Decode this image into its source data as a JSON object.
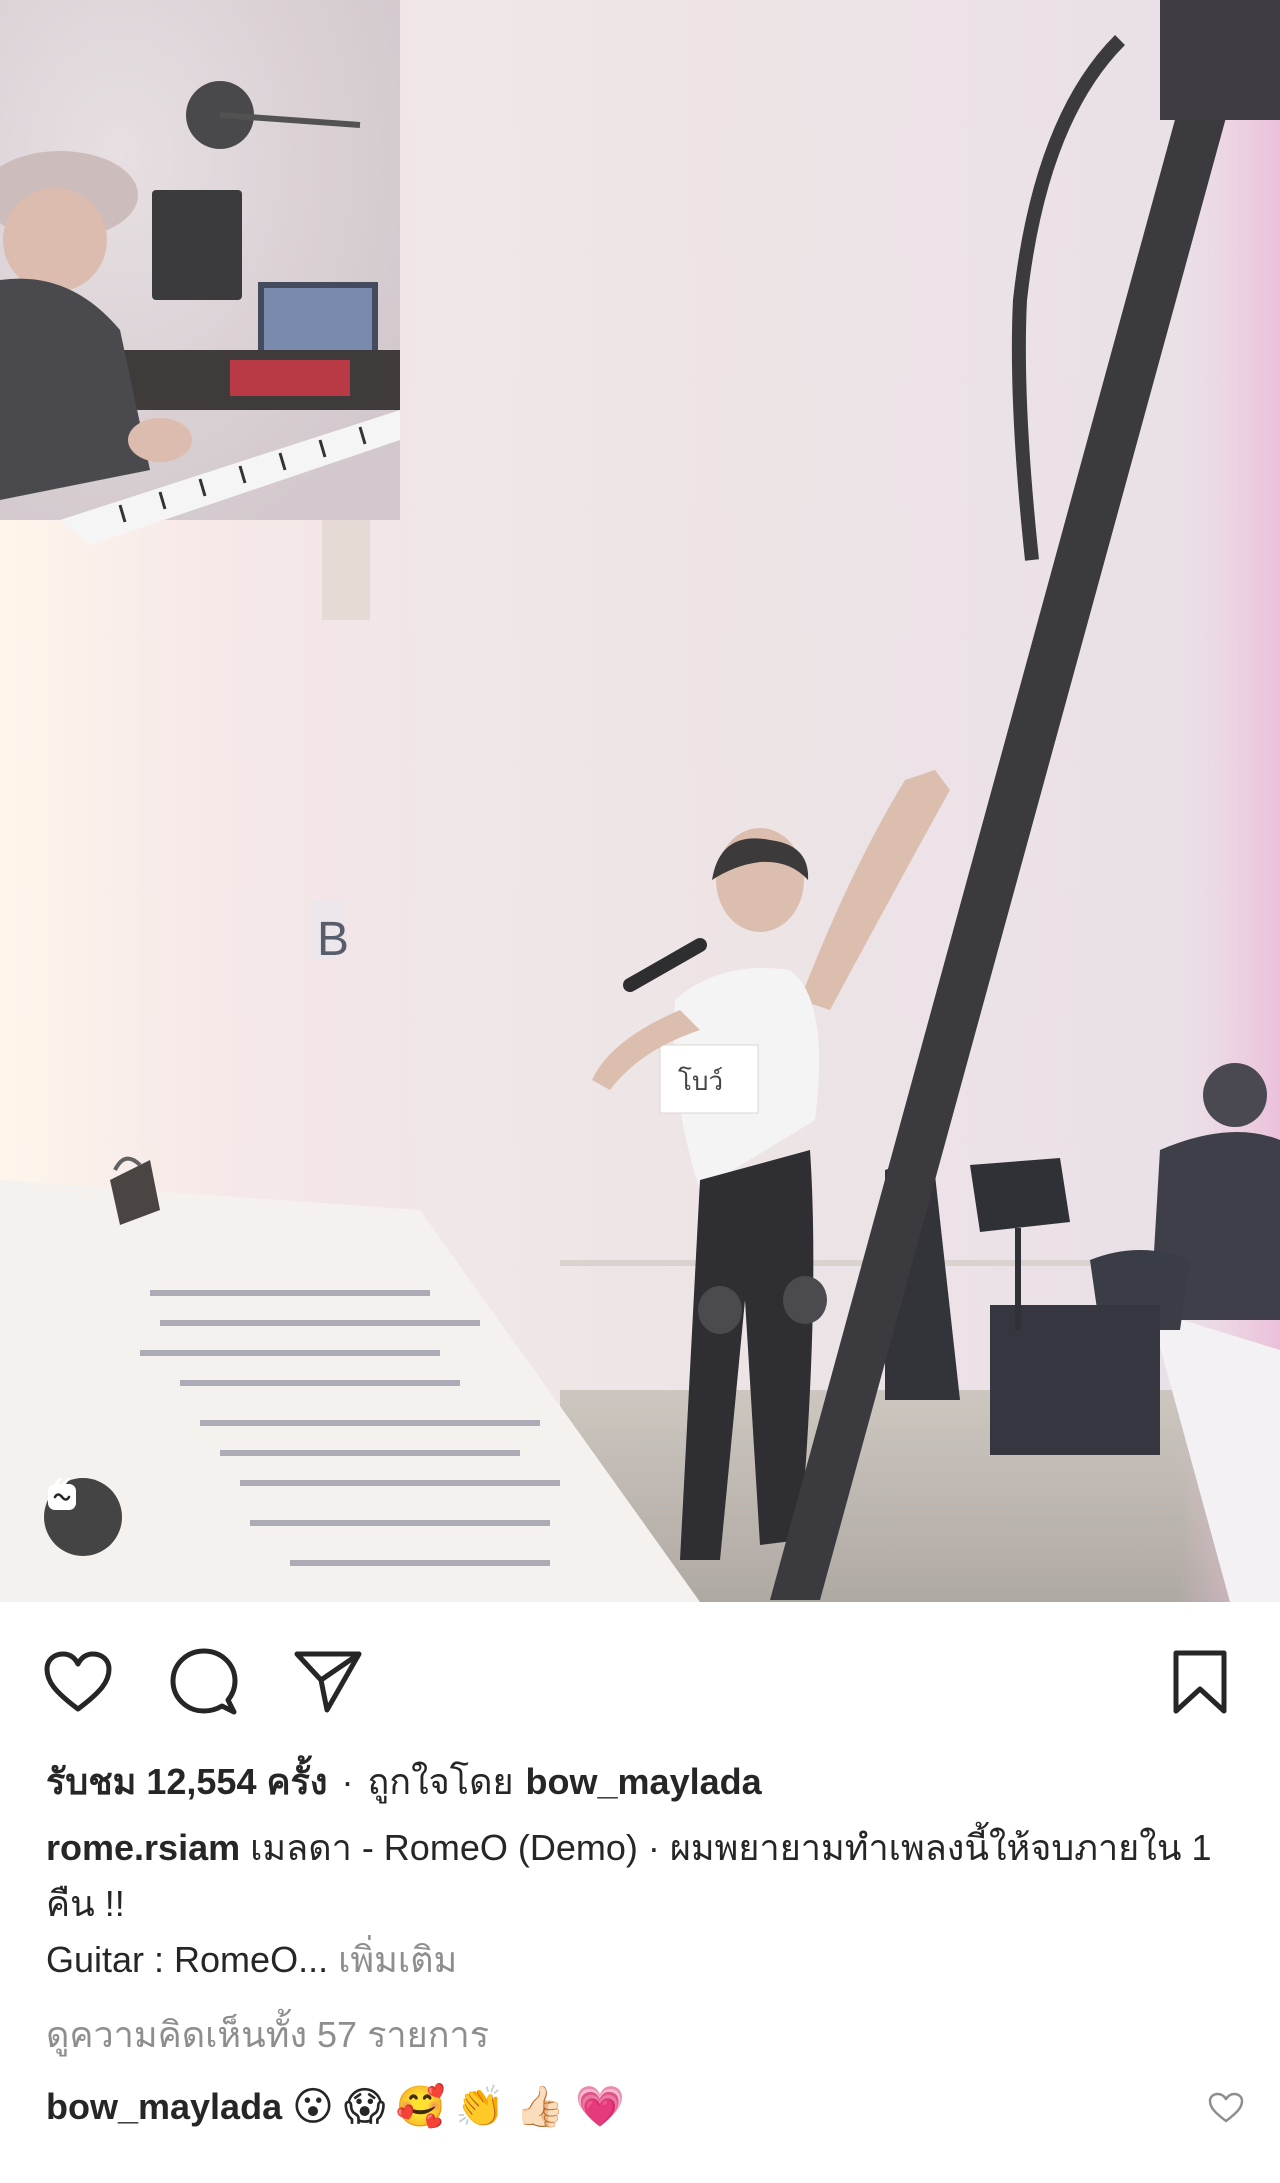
{
  "post": {
    "views_text": "รับชม 12,554 ครั้ง",
    "separator": "·",
    "liked_by_prefix": "ถูกใจโดย",
    "liked_by_user": "bow_maylada",
    "author": "rome.rsiam",
    "caption_line1": "เมลดา - RomeO (Demo) · ผมพยายามทำเพลงนี้ให้จบภายใน 1 คืน !!",
    "caption_line2": "Guitar : RomeO...",
    "more_label": "เพิ่มเติม",
    "view_comments": "ดูความคิดเห็นทั้ง 57 รายการ",
    "comment": {
      "user": "bow_maylada",
      "emojis": [
        "😮",
        "😱",
        "🥰",
        "👏",
        "👍🏻",
        "💗"
      ]
    },
    "media": {
      "badge_icon": "reels-icon",
      "sign_letter": "B",
      "name_tag": "โบว์"
    }
  },
  "icons": {
    "like": "heart-icon",
    "comment": "comment-bubble-icon",
    "share": "paper-plane-icon",
    "save": "bookmark-icon",
    "comment_like": "small-heart-icon"
  },
  "colors": {
    "text": "#262626",
    "muted": "#8e8e8e",
    "background": "#ffffff"
  }
}
